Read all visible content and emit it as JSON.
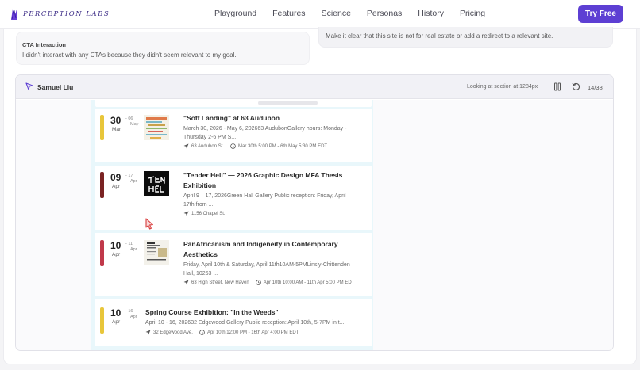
{
  "nav": {
    "logo_text": "PERCEPTION LABS",
    "links": [
      "Playground",
      "Features",
      "Science",
      "Personas",
      "History",
      "Pricing"
    ],
    "cta": "Try Free",
    "accent": "#5d3fd3"
  },
  "feedback": {
    "cta_label": "CTA Interaction",
    "cta_text": "I didn't interact with any CTAs because they didn't seem relevant to my goal.",
    "recommendation": "Make it clear that this site is not for real estate or add a redirect to a relevant site."
  },
  "session": {
    "user": "Samuel Liu",
    "section_text": "Looking at section at 1284px",
    "counter": "14/38",
    "icons": [
      "cursor-icon",
      "pause-icon",
      "replay-icon"
    ]
  },
  "events": [
    {
      "day": "30",
      "end_day": "06",
      "month": "Mar",
      "end_month": "May",
      "color": "#e8c63a",
      "title_lines": [
        "\"Soft Landing\" at 63 Audubon"
      ],
      "desc_lines": [
        "March 30, 2026 - May 6, 202663 AudubonGallery hours: Monday -",
        "Thursday 2-6 PM S..."
      ],
      "location": "63 Audubon St.",
      "time": "Mar 30th 5:00 PM - 6th May 5:30 PM EDT"
    },
    {
      "day": "09",
      "end_day": "17",
      "month": "Apr",
      "end_month": "Apr",
      "color": "#7a2323",
      "title_lines": [
        "\"Tender Hell\" — 2026 Graphic Design MFA Thesis",
        "Exhibition"
      ],
      "desc_lines": [
        "April 9 – 17, 2026Green Hall Gallery Public reception: Friday, April",
        "17th from ..."
      ],
      "location": "1156 Chapel St.",
      "time": ""
    },
    {
      "day": "10",
      "end_day": "11",
      "month": "Apr",
      "end_month": "Apr",
      "color": "#c0394a",
      "title_lines": [
        "PanAfricanism and Indigeneity in Contemporary",
        "Aesthetics"
      ],
      "desc_lines": [
        "Friday, April 10th & Saturday, April 11th10AM-5PMLinsly-Chittenden",
        "Hall, 10263 ..."
      ],
      "location": "63 High Street, New Haven",
      "time": "Apr 10th 10:00 AM - 11th Apr 5:00 PM EDT"
    },
    {
      "day": "10",
      "end_day": "16",
      "month": "Apr",
      "end_month": "Apr",
      "color": "#e8c63a",
      "title_lines": [
        "Spring Course Exhibition: \"In the Weeds\""
      ],
      "desc_lines": [
        "April 10 - 16, 202632 Edgewood Gallery Public reception: April 10th, 5-7PM in t..."
      ],
      "location": "32 Edgewood Ave.",
      "time": "Apr 10th 12:00 PM - 16th Apr 4:00 PM EDT"
    }
  ]
}
